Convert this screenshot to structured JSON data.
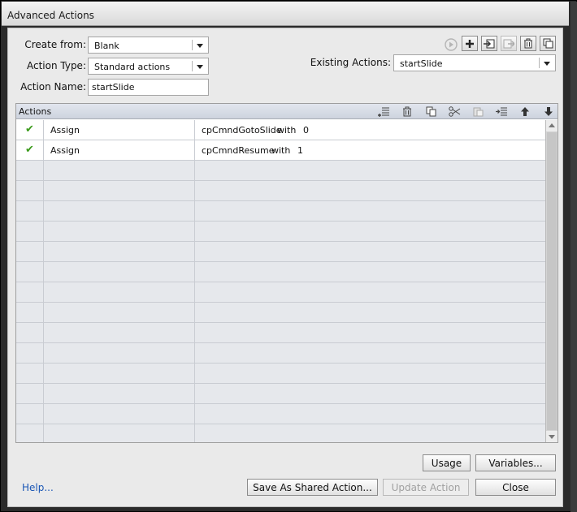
{
  "window": {
    "title": "Advanced Actions"
  },
  "form": {
    "create_from_label": "Create from:",
    "create_from_value": "Blank",
    "action_type_label": "Action Type:",
    "action_type_value": "Standard actions",
    "action_name_label": "Action Name:",
    "action_name_value": "startSlide",
    "existing_actions_label": "Existing Actions:",
    "existing_actions_value": "startSlide"
  },
  "toolbar_icons": [
    "preview-icon",
    "add-icon",
    "import-icon",
    "export-icon",
    "delete-icon",
    "duplicate-icon"
  ],
  "grid": {
    "header": "Actions",
    "header_icons": [
      "insert-icon",
      "trash-icon",
      "copy-icon",
      "cut-icon",
      "paste-icon",
      "indent-icon",
      "move-up-icon",
      "move-down-icon"
    ],
    "rows": [
      {
        "status": "check",
        "action": "Assign",
        "target": "cpCmndGotoSlide",
        "with": "with",
        "value": "0"
      },
      {
        "status": "check",
        "action": "Assign",
        "target": "cpCmndResume",
        "with": "with",
        "value": "1"
      }
    ],
    "empty_rows": 14
  },
  "buttons": {
    "usage": "Usage",
    "variables": "Variables...",
    "save_shared": "Save As Shared Action...",
    "update": "Update Action",
    "close": "Close",
    "help": "Help..."
  },
  "colors": {
    "check": "#3a9a1a",
    "link": "#1a56b5"
  }
}
